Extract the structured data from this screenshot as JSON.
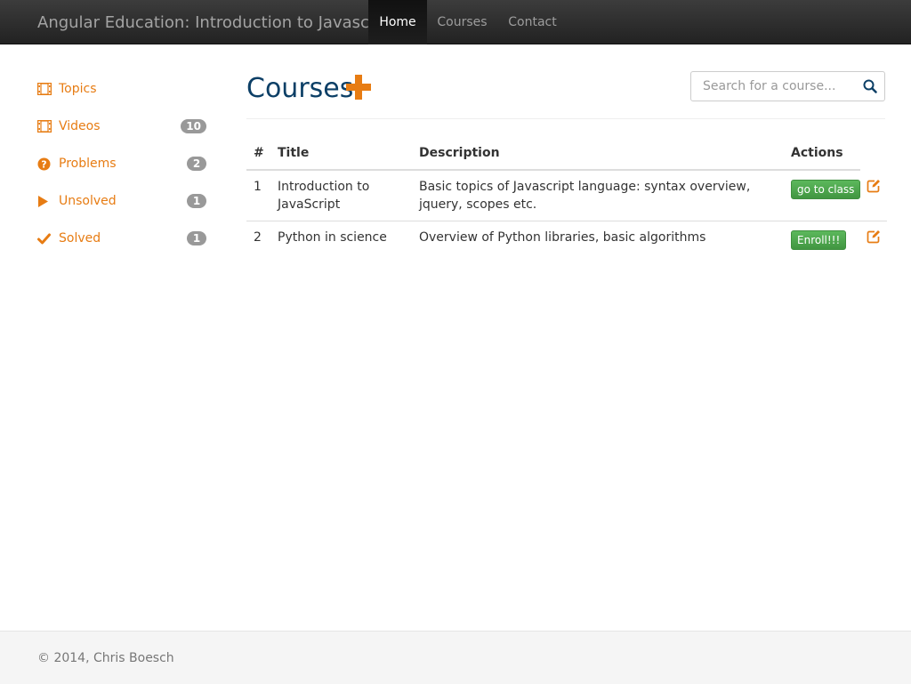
{
  "navbar": {
    "brand": "Angular Education: Introduction to Javascript",
    "items": [
      {
        "label": "Home",
        "active": true
      },
      {
        "label": "Courses",
        "active": false
      },
      {
        "label": "Contact",
        "active": false
      }
    ]
  },
  "sidebar": {
    "items": [
      {
        "label": "Topics",
        "icon": "film-icon",
        "badge": ""
      },
      {
        "label": "Videos",
        "icon": "film-icon",
        "badge": "10"
      },
      {
        "label": "Problems",
        "icon": "question-circle-icon",
        "badge": "2"
      },
      {
        "label": "Unsolved",
        "icon": "play-icon",
        "badge": "1"
      },
      {
        "label": "Solved",
        "icon": "checkmark-icon",
        "badge": "1"
      }
    ]
  },
  "main": {
    "title": "Courses",
    "add_icon": "plus-icon",
    "search": {
      "placeholder": "Search for a course...",
      "value": "",
      "icon": "search-icon"
    },
    "table": {
      "headers": {
        "num": "#",
        "title": "Title",
        "description": "Description",
        "actions": "Actions"
      },
      "rows": [
        {
          "num": "1",
          "title": "Introduction to JavaScript",
          "description": "Basic topics of Javascript language: syntax overview, jquery, scopes etc.",
          "action": "go to class"
        },
        {
          "num": "2",
          "title": "Python in science",
          "description": "Overview of Python libraries, basic algorithms",
          "action": "Enroll!!!"
        }
      ]
    }
  },
  "footer": {
    "text": "© 2014, Chris Boesch"
  },
  "colors": {
    "accent": "#e77c13",
    "title": "#0c3f66",
    "button": "#5cb85c",
    "badge": "#999999",
    "navbar": "#2b2b2b"
  }
}
